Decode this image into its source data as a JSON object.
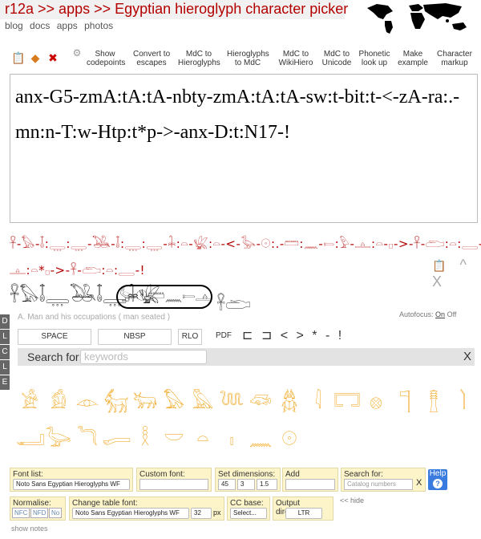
{
  "header": {
    "site_title": "r12a >> apps >> Egyptian hieroglyph character picker",
    "nav": [
      "blog",
      "docs",
      "apps",
      "photos"
    ]
  },
  "toolbar": {
    "icons": [
      "notepad-icon",
      "diamond-icon",
      "close-icon",
      "gear-icon"
    ],
    "buttons": [
      {
        "line1": "Show",
        "line2": "codepoints"
      },
      {
        "line1": "Convert to",
        "line2": "escapes"
      },
      {
        "line1": "MdC to",
        "line2": "Hieroglyphs"
      },
      {
        "line1": "Hieroglyphs",
        "line2": "to MdC"
      },
      {
        "line1": "MdC to",
        "line2": "WikiHiero"
      },
      {
        "line1": "MdC to",
        "line2": "Unicode"
      },
      {
        "line1": "Phonetic",
        "line2": "look up"
      },
      {
        "line1": "Make",
        "line2": "example"
      },
      {
        "line1": "Character",
        "line2": "markup"
      }
    ]
  },
  "main_text": "anx-G5-zmA:tA:tA-nbty-zmA:tA:tA-sw:t-bit:t-<-zA-ra:.-mn:n-T:w-Htp:t*p->-anx-D:t:N17-!",
  "hieroglyph_output": {
    "row1": "𓋹-𓅃-𓄤:𓇾:𓇾-𓅒-𓄤:𓇾:𓇾-𓇓:𓏏-𓆤:𓏏-<-𓅭-𓇳:.-𓏠:𓈖-𓍿:𓅱-𓊵:𓏏-𓊪->-𓋹-𓂧:𓏏:𓇿-!",
    "row2": "𓊵:𓏏*𓊪->-𓋹-𓂧:𓏏:𓇿-!",
    "controls": [
      "notepad-icon",
      "^",
      "X"
    ]
  },
  "result_glyphs": "𓋹𓅃𓄤𓇾𓅒𓄤𓇾𓇓𓆤",
  "cartouche_glyphs": "𓅭𓇳𓏠𓈖𓍿𓊵",
  "category_label": "A. Man and his occupations ( man seated )",
  "autofocus": {
    "label": "Autofocus:",
    "on": "On",
    "off": "Off"
  },
  "side_tabs": [
    "D",
    "L",
    "C",
    "L",
    "E"
  ],
  "special_chars": {
    "buttons": [
      "SPACE",
      "NBSP",
      "RLO",
      "PDF"
    ],
    "symbols": "⊏ ⊐ < > * - !"
  },
  "search": {
    "label": "Search for:",
    "placeholder": "keywords",
    "close": "X"
  },
  "glyph_grid": {
    "row1": [
      "𓀀",
      "𓀁",
      "𓁹",
      "𓃶",
      "𓃒",
      "𓅃",
      "𓅓",
      "𓆙",
      "𓆛",
      "𓆣",
      "𓇋",
      "𓉐",
      "𓊖",
      "𓊹",
      "𓊽",
      "𓌙"
    ],
    "row2": [
      "𓂝",
      "𓅬",
      "𓆓",
      "𓂷",
      "𓎛",
      "𓎟",
      "𓏏",
      "𓏤",
      "𓈖",
      "𓇳"
    ]
  },
  "bottom_panel": {
    "font_list": {
      "label": "Font list:",
      "value": "Noto Sans Egyptian Hieroglyphs WF"
    },
    "custom_font": {
      "label": "Custom font:",
      "value": ""
    },
    "set_dimensions": {
      "label": "Set dimensions:",
      "values": [
        "45",
        "3",
        "1.5"
      ]
    },
    "add_codepoint": {
      "label": "Add codepoint:",
      "value": ""
    },
    "search_for": {
      "label": "Search for:",
      "placeholder": "Catalog numbers",
      "clear": "X"
    },
    "help": "Help",
    "normalise": {
      "label": "Normalise: NFC",
      "options": [
        "NFC",
        "NFD",
        "No"
      ]
    },
    "table_font": {
      "label": "Change table font:",
      "value": "Noto Sans Egyptian Hieroglyphs WF",
      "size": "32",
      "unit": "px"
    },
    "cc_base": {
      "label": "CC base:",
      "value": "Select..."
    },
    "output_direction": {
      "label": "Output direction:",
      "value": "LTR"
    },
    "hide_link": "<< hide"
  },
  "show_notes": "show notes",
  "colors": {
    "accent": "#b30000",
    "glyph": "#f09a00",
    "panel": "#fdf5c9",
    "help": "#3a7be0"
  }
}
